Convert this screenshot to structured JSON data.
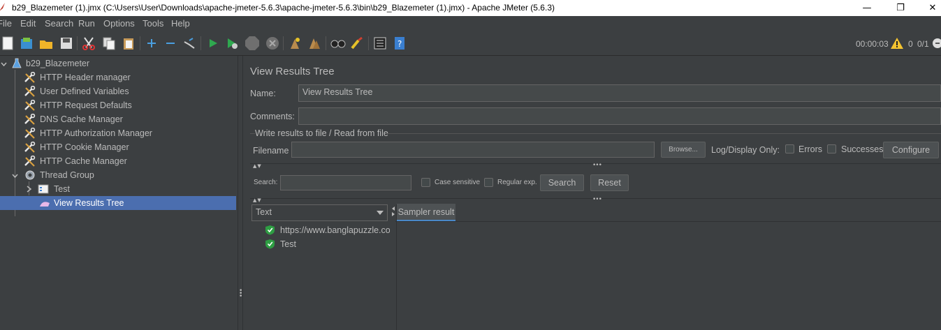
{
  "window": {
    "title": "b29_Blazemeter (1).jmx (C:\\Users\\User\\Downloads\\apache-jmeter-5.6.3\\apache-jmeter-5.6.3\\bin\\b29_Blazemeter (1).jmx) - Apache JMeter (5.6.3)",
    "minimize": "—",
    "maximize": "❐",
    "close": "✕"
  },
  "menu": {
    "items": [
      "File",
      "Edit",
      "Search",
      "Run",
      "Options",
      "Tools",
      "Help"
    ]
  },
  "toolbar": {
    "icons": [
      "new-icon",
      "templates-icon",
      "open-icon",
      "save-icon",
      "cut-icon",
      "copy-icon",
      "paste-icon",
      "expand-icon",
      "collapse-icon",
      "toggle-icon",
      "start-icon",
      "start-no-timers-icon",
      "stop-icon",
      "shutdown-icon",
      "clear-icon",
      "clear-all-icon",
      "search-icon",
      "reset-search-icon",
      "function-helper-icon",
      "help-icon"
    ],
    "timer": "00:00:03",
    "warning_count": "0",
    "threads": "0/1"
  },
  "tree": {
    "root": "b29_Blazemeter",
    "items": [
      {
        "label": "HTTP Header manager",
        "icon": "config-wrench-icon"
      },
      {
        "label": "User Defined Variables",
        "icon": "config-wrench-icon"
      },
      {
        "label": "HTTP Request Defaults",
        "icon": "config-wrench-icon"
      },
      {
        "label": "DNS Cache Manager",
        "icon": "config-wrench-icon"
      },
      {
        "label": "HTTP Authorization Manager",
        "icon": "config-wrench-icon"
      },
      {
        "label": "HTTP Cookie Manager",
        "icon": "config-wrench-icon"
      },
      {
        "label": "HTTP Cache Manager",
        "icon": "config-wrench-icon"
      }
    ],
    "thread_group": "Thread Group",
    "child": "Test",
    "selected": "View Results Tree"
  },
  "panel": {
    "title": "View Results Tree",
    "name_label": "Name:",
    "name_value": "View Results Tree",
    "comments_label": "Comments:",
    "comments_value": "",
    "group_title": "Write results to file / Read from file",
    "filename_label": "Filename",
    "filename_value": "",
    "browse": "Browse...",
    "log_display": "Log/Display Only:",
    "errors": "Errors",
    "successes": "Successes",
    "configure": "Configure",
    "search_label": "Search:",
    "search_value": "",
    "case_sensitive": "Case sensitive",
    "regular_exp": "Regular exp.",
    "search_button": "Search",
    "reset_button": "Reset",
    "renderer": "Text",
    "results": [
      "https://www.banglapuzzle.com",
      "Test"
    ],
    "tab": "Sampler result"
  },
  "colors": {
    "background": "#3c3f41",
    "selection": "#4b6eaf",
    "success": "#2e9e43"
  }
}
